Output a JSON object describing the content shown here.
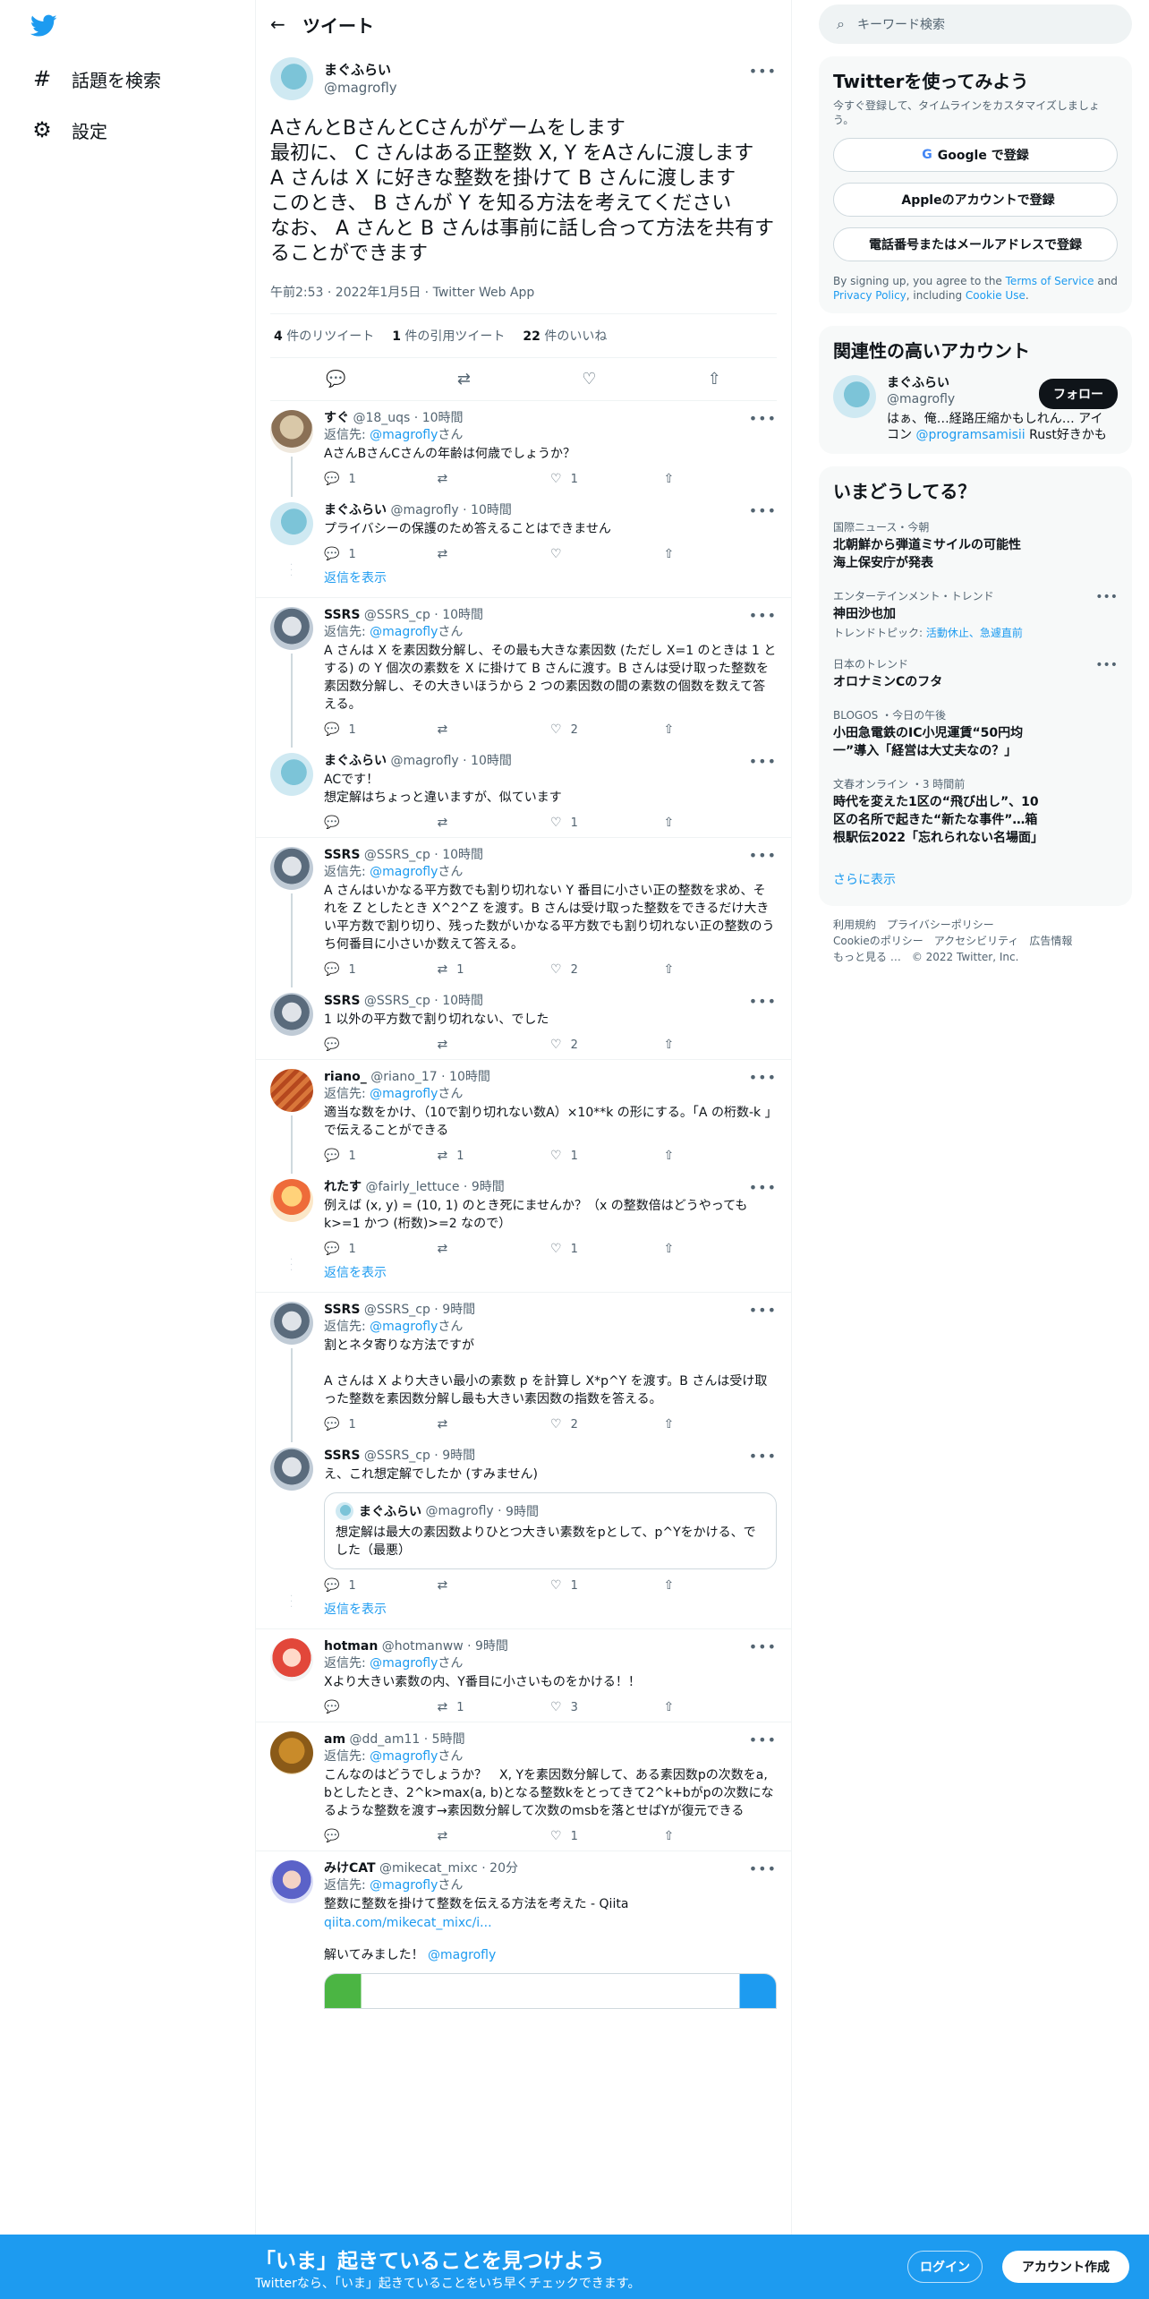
{
  "nav": {
    "explore": "話題を検索",
    "settings": "設定"
  },
  "header": {
    "title": "ツイート"
  },
  "main_tweet": {
    "display_name": "まぐふらい",
    "handle": "@magrofly",
    "text": "AさんとBさんとCさんがゲームをします\n最初に、 C さんはある正整数 X, Y をAさんに渡します\nA さんは X に好きな整数を掛けて B さんに渡します\nこのとき、 B さんが Y を知る方法を考えてください\nなお、 A さんと B さんは事前に話し合って方法を共有することができます",
    "meta": "午前2:53 · 2022年1月5日 · Twitter Web App",
    "retweets": "4",
    "retweets_label": "件のリツイート",
    "quotes": "1",
    "quotes_label": "件の引用ツイート",
    "likes": "22",
    "likes_label": "件のいいね"
  },
  "replies": [
    {
      "name": "すぐ",
      "handle": "@18_uqs",
      "time": "10時間",
      "reply_to": "@magrofly",
      "text": "AさんBさんCさんの年齢は何歳でしょうか？",
      "reply_count": "1",
      "rt": "",
      "like": "1"
    },
    {
      "name": "まぐふらい",
      "handle": "@magrofly",
      "time": "10時間",
      "reply_to": "",
      "text": "プライバシーの保護のため答えることはできません",
      "reply_count": "1",
      "rt": "",
      "like": ""
    },
    {
      "name": "SSRS",
      "handle": "@SSRS_cp",
      "time": "10時間",
      "reply_to": "@magrofly",
      "text": "A さんは X を素因数分解し、その最も大きな素因数 (ただし X=1 のときは 1 とする) の Y 個次の素数を X に掛けて B さんに渡す。B さんは受け取った整数を素因数分解し、その大きいほうから 2 つの素因数の間の素数の個数を数えて答える。",
      "reply_count": "1",
      "rt": "",
      "like": "2"
    },
    {
      "name": "まぐふらい",
      "handle": "@magrofly",
      "time": "10時間",
      "reply_to": "",
      "text": "ACです！\n想定解はちょっと違いますが、似ています",
      "reply_count": "",
      "rt": "",
      "like": "1"
    },
    {
      "name": "SSRS",
      "handle": "@SSRS_cp",
      "time": "10時間",
      "reply_to": "@magrofly",
      "text": "A さんはいかなる平方数でも割り切れない Y 番目に小さい正の整数を求め、それを Z としたとき X^2^Z を渡す。B さんは受け取った整数をできるだけ大きい平方数で割り切り、残った数がいかなる平方数でも割り切れない正の整数のうち何番目に小さいか数えて答える。",
      "reply_count": "1",
      "rt": "1",
      "like": "2"
    },
    {
      "name": "SSRS",
      "handle": "@SSRS_cp",
      "time": "10時間",
      "reply_to": "",
      "text": "1 以外の平方数で割り切れない、でした",
      "reply_count": "",
      "rt": "",
      "like": "2"
    },
    {
      "name": "riano_",
      "handle": "@riano_17",
      "time": "10時間",
      "reply_to": "@magrofly",
      "text": "適当な数をかけ、（10で割り切れない数A）×10**k の形にする。「A の桁数-k 」で伝えることができる",
      "reply_count": "1",
      "rt": "1",
      "like": "1"
    },
    {
      "name": "れたす",
      "handle": "@fairly_lettuce",
      "time": "9時間",
      "reply_to": "",
      "text": "例えば (x, y) = (10, 1) のとき死にませんか？（x の整数倍はどうやっても k>=1 かつ (桁数)>=2 なので）",
      "reply_count": "1",
      "rt": "",
      "like": "1"
    },
    {
      "name": "SSRS",
      "handle": "@SSRS_cp",
      "time": "9時間",
      "reply_to": "@magrofly",
      "text": "割とネタ寄りな方法ですが\n\nA さんは X より大きい最小の素数 p を計算し X*p^Y を渡す。B さんは受け取った整数を素因数分解し最も大きい素因数の指数を答える。",
      "reply_count": "1",
      "rt": "",
      "like": "2"
    },
    {
      "name": "SSRS",
      "handle": "@SSRS_cp",
      "time": "9時間",
      "reply_to": "",
      "text": "え、これ想定解でしたか (すみません)",
      "reply_count": "1",
      "rt": "",
      "like": "1"
    },
    {
      "name": "hotman",
      "handle": "@hotmanww",
      "time": "9時間",
      "reply_to": "@magrofly",
      "text": "Xより大きい素数の内、Y番目に小さいものをかける！！",
      "reply_count": "",
      "rt": "1",
      "like": "3"
    },
    {
      "name": "am",
      "handle": "@dd_am11",
      "time": "5時間",
      "reply_to": "@magrofly",
      "text": "こんなのはどうでしょうか？　X, Yを素因数分解して、ある素因数pの次数をa, bとしたとき、2^k>max(a, b)となる整数kをとってきて2^k+bがpの次数になるような整数を渡す→素因数分解して次数のmsbを落とせばYが復元できる",
      "reply_count": "",
      "rt": "",
      "like": "1"
    },
    {
      "name": "みけCAT",
      "handle": "@mikecat_mixc",
      "time": "20分",
      "reply_to": "@magrofly",
      "text": "整数に整数を掛けて整数を伝える方法を考えた - Qiita",
      "link": "qiita.com/mikecat_mixc/i...",
      "text2": "解いてみました！",
      "mention2": "@magrofly"
    }
  ],
  "reply_prefix": "返信先: ",
  "reply_suffix": "さん",
  "show_replies": "返信を表示",
  "quote": {
    "name": "まぐふらい",
    "handle": "@magrofly",
    "time": "9時間",
    "text": "想定解は最大の素因数よりひとつ大きい素数をpとして、p^Yをかける、でした（最悪）"
  },
  "sidebar": {
    "search_placeholder": "キーワード検索",
    "signup": {
      "title": "Twitterを使ってみよう",
      "sub": "今すぐ登録して、タイムラインをカスタマイズしましょう。",
      "google": "Google で登録",
      "apple": "Appleのアカウントで登録",
      "phone": "電話番号またはメールアドレスで登録",
      "terms_pre": "By signing up, you agree to the ",
      "terms_link": "Terms of Service",
      "terms_and": " and ",
      "privacy_link": "Privacy Policy",
      "terms_incl": ", including ",
      "cookie_link": "Cookie Use",
      "terms_end": "."
    },
    "related": {
      "title": "関連性の高いアカウント",
      "name": "まぐふらい",
      "handle": "@magrofly",
      "follow": "フォロー",
      "bio_pre": "はぁ、俺…経路圧縮かもしれん… アイコン ",
      "bio_mention": "@programsamisii",
      "bio_post": " Rust好きかも"
    },
    "trends": {
      "title": "いまどうしてる？",
      "items": [
        {
          "cat": "国際ニュース・今朝",
          "title": "北朝鮮から弾道ミサイルの可能性\n海上保安庁が発表",
          "sub": ""
        },
        {
          "cat": "エンターテインメント・トレンド",
          "title": "神田沙也加",
          "sub_pre": "トレンドトピック: ",
          "sub_links": "活動休止、急遽直前"
        },
        {
          "cat": "日本のトレンド",
          "title": "オロナミンCのフタ",
          "sub": ""
        },
        {
          "cat": "BLOGOS ・今日の午後",
          "title": "小田急電鉄のIC小児運賃“50円均一”導入「経営は大丈夫なの？」",
          "sub": ""
        },
        {
          "cat": "文春オンライン ・3 時間前",
          "title": "時代を変えた1区の“飛び出し”、10区の名所で起きた“新たな事件”…箱根駅伝2022「忘れられない名場面」",
          "sub": ""
        }
      ],
      "show_more": "さらに表示"
    },
    "footer": [
      "利用規約",
      "プライバシーポリシー",
      "Cookieのポリシー",
      "アクセシビリティ",
      "広告情報",
      "もっと見る …",
      "© 2022 Twitter, Inc."
    ]
  },
  "bottom": {
    "title": "「いま」起きていることを見つけよう",
    "sub": "Twitterなら、「いま」起きていることをいち早くチェックできます。",
    "login": "ログイン",
    "signup": "アカウント作成"
  },
  "colors": {
    "accent": "#1d9bf0",
    "text": "#0f1419",
    "muted": "#536471"
  }
}
